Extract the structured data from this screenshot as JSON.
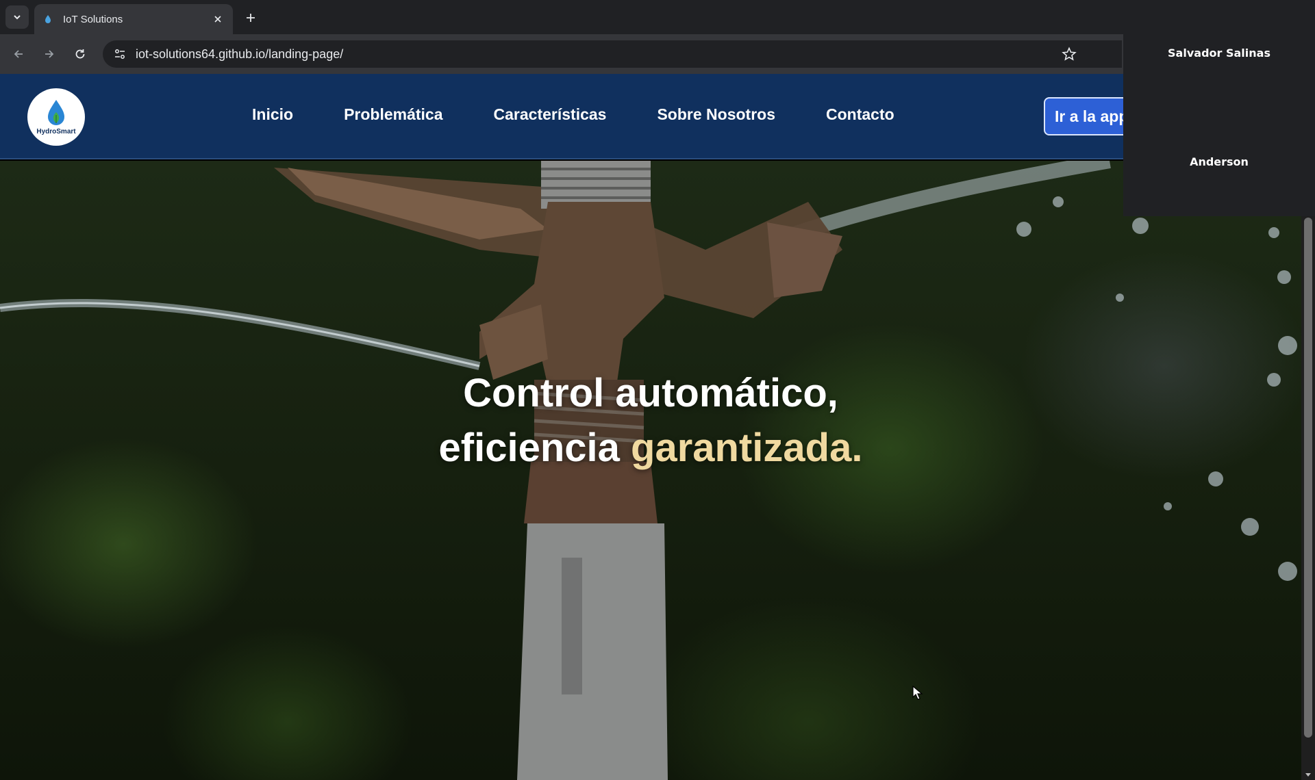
{
  "browser": {
    "tab_title": "IoT Solutions",
    "url": "iot-solutions64.github.io/landing-page/"
  },
  "site": {
    "logo_text": "HydroSmart",
    "nav": [
      {
        "label": "Inicio"
      },
      {
        "label": "Problemática"
      },
      {
        "label": "Características"
      },
      {
        "label": "Sobre Nosotros"
      },
      {
        "label": "Contacto"
      }
    ],
    "cta_label": "Ir a la app",
    "hero": {
      "line1": "Control automático,",
      "line2_start": "eficiencia ",
      "line2_accent": "garantizada."
    }
  },
  "call": {
    "participants": [
      "Salvador Salinas",
      "Anderson"
    ]
  },
  "colors": {
    "navbar": "#10305e",
    "cta": "#2d60d6",
    "accent_text": "#f0d9a0"
  }
}
